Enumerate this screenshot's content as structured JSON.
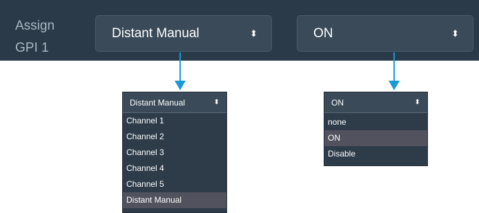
{
  "assign": {
    "line1": "Assign",
    "line2": "GPI 1"
  },
  "select_channel": {
    "value": "Distant Manual",
    "caret": "⬍"
  },
  "select_state": {
    "value": "ON",
    "caret": "⬍"
  },
  "dropdown_channel": {
    "value": "Distant Manual",
    "caret": "⬍",
    "options": [
      "Channel 1",
      "Channel 2",
      "Channel 3",
      "Channel 4",
      "Channel 5",
      "Distant Manual"
    ],
    "selected": "Distant Manual"
  },
  "dropdown_state": {
    "value": "ON",
    "caret": "⬍",
    "options": [
      "none",
      "ON",
      "Disable"
    ],
    "selected": "ON"
  },
  "colors": {
    "bar": "#2b3a48",
    "select_bg": "#3a4a58",
    "dropdown_bg": "#2e3c4a",
    "selected_bg": "#52525e",
    "arrow": "#1a9ad6"
  }
}
